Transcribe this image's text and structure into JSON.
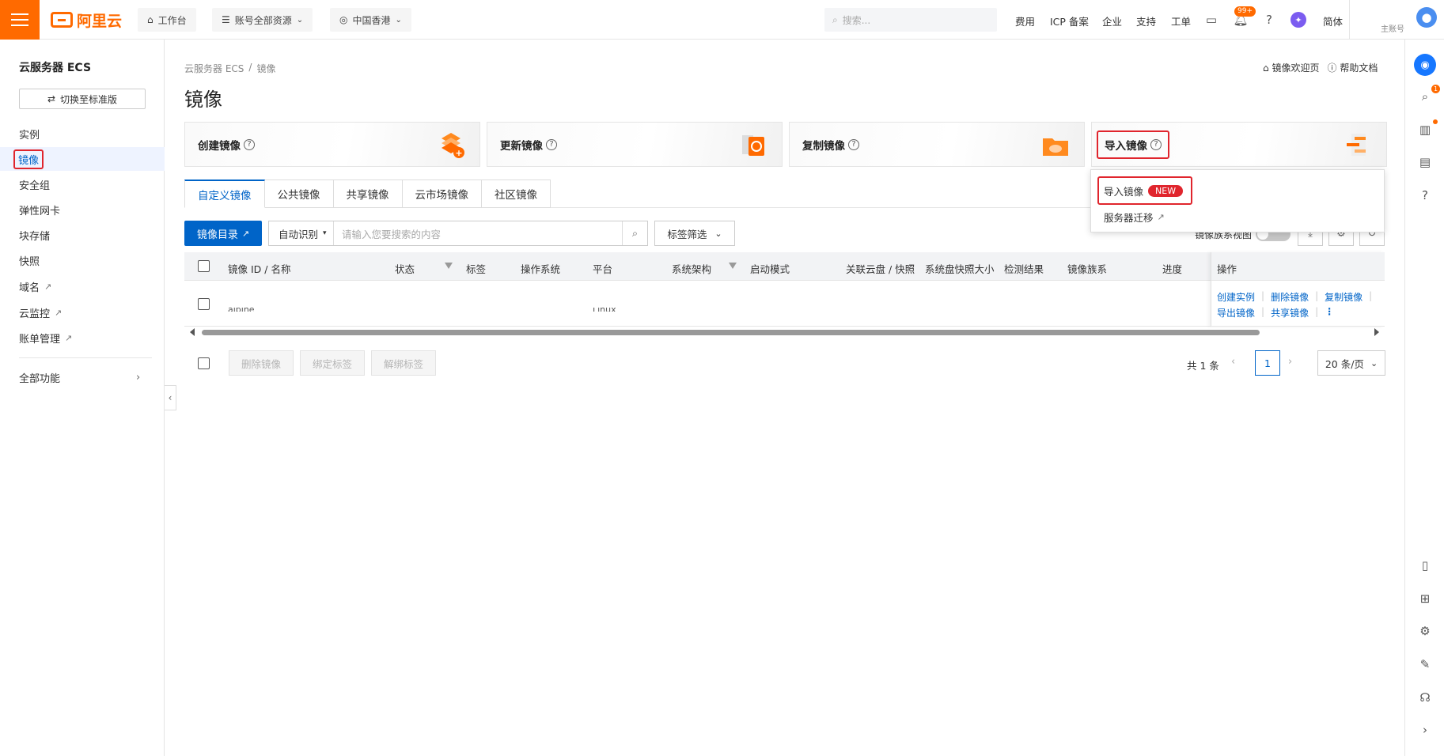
{
  "topbar": {
    "logo_text": "阿里云",
    "workbench": "工作台",
    "resources": "账号全部资源",
    "region": "中国香港",
    "search_placeholder": "搜索...",
    "nav": [
      "费用",
      "ICP 备案",
      "企业",
      "支持",
      "工单"
    ],
    "notif_badge": "99+",
    "lang": "简体",
    "account_label": "主账号"
  },
  "sidebar": {
    "title": "云服务器 ECS",
    "switch_label": "切换至标准版",
    "items": [
      {
        "label": "实例"
      },
      {
        "label": "镜像"
      },
      {
        "label": "安全组"
      },
      {
        "label": "弹性网卡"
      },
      {
        "label": "块存储"
      },
      {
        "label": "快照"
      },
      {
        "label": "域名"
      },
      {
        "label": "云监控"
      },
      {
        "label": "账单管理"
      }
    ],
    "all_features": "全部功能"
  },
  "breadcrumb": [
    "云服务器 ECS",
    "/",
    "镜像"
  ],
  "page_title": "镜像",
  "header_links": {
    "welcome": "镜像欢迎页",
    "help": "帮助文档"
  },
  "cards": [
    {
      "label": "创建镜像"
    },
    {
      "label": "更新镜像"
    },
    {
      "label": "复制镜像"
    },
    {
      "label": "导入镜像"
    }
  ],
  "tabs": [
    "自定义镜像",
    "公共镜像",
    "共享镜像",
    "云市场镜像",
    "社区镜像"
  ],
  "toolbar": {
    "catalog_btn": "镜像目录",
    "search_mode": "自动识别",
    "search_placeholder": "请输入您要搜索的内容",
    "tag_filter": "标签筛选",
    "family_toggle_label": "镜像族系视图"
  },
  "table": {
    "columns": [
      "镜像 ID / 名称",
      "状态",
      "标签",
      "操作系统",
      "平台",
      "系统架构",
      "启动模式",
      "关联云盘 / 快照",
      "系统盘快照大小",
      "检测结果",
      "镜像族系",
      "进度",
      "操作"
    ],
    "row": {
      "name_partial": "alpine",
      "platform_partial": "Linux",
      "ops_line1": [
        "创建实例",
        "删除镜像",
        "复制镜像"
      ],
      "ops_line2": [
        "导出镜像",
        "共享镜像"
      ]
    }
  },
  "bulk_actions": [
    "删除镜像",
    "绑定标签",
    "解绑标签"
  ],
  "pagination": {
    "total": "共 1 条",
    "current": "1",
    "page_size": "20 条/页"
  },
  "dropdown": {
    "item1": "导入镜像",
    "item1_badge": "NEW",
    "item2": "服务器迁移"
  },
  "colors": {
    "brand": "#ff6a00",
    "primary": "#0064c8",
    "highlight": "#e0252d"
  }
}
